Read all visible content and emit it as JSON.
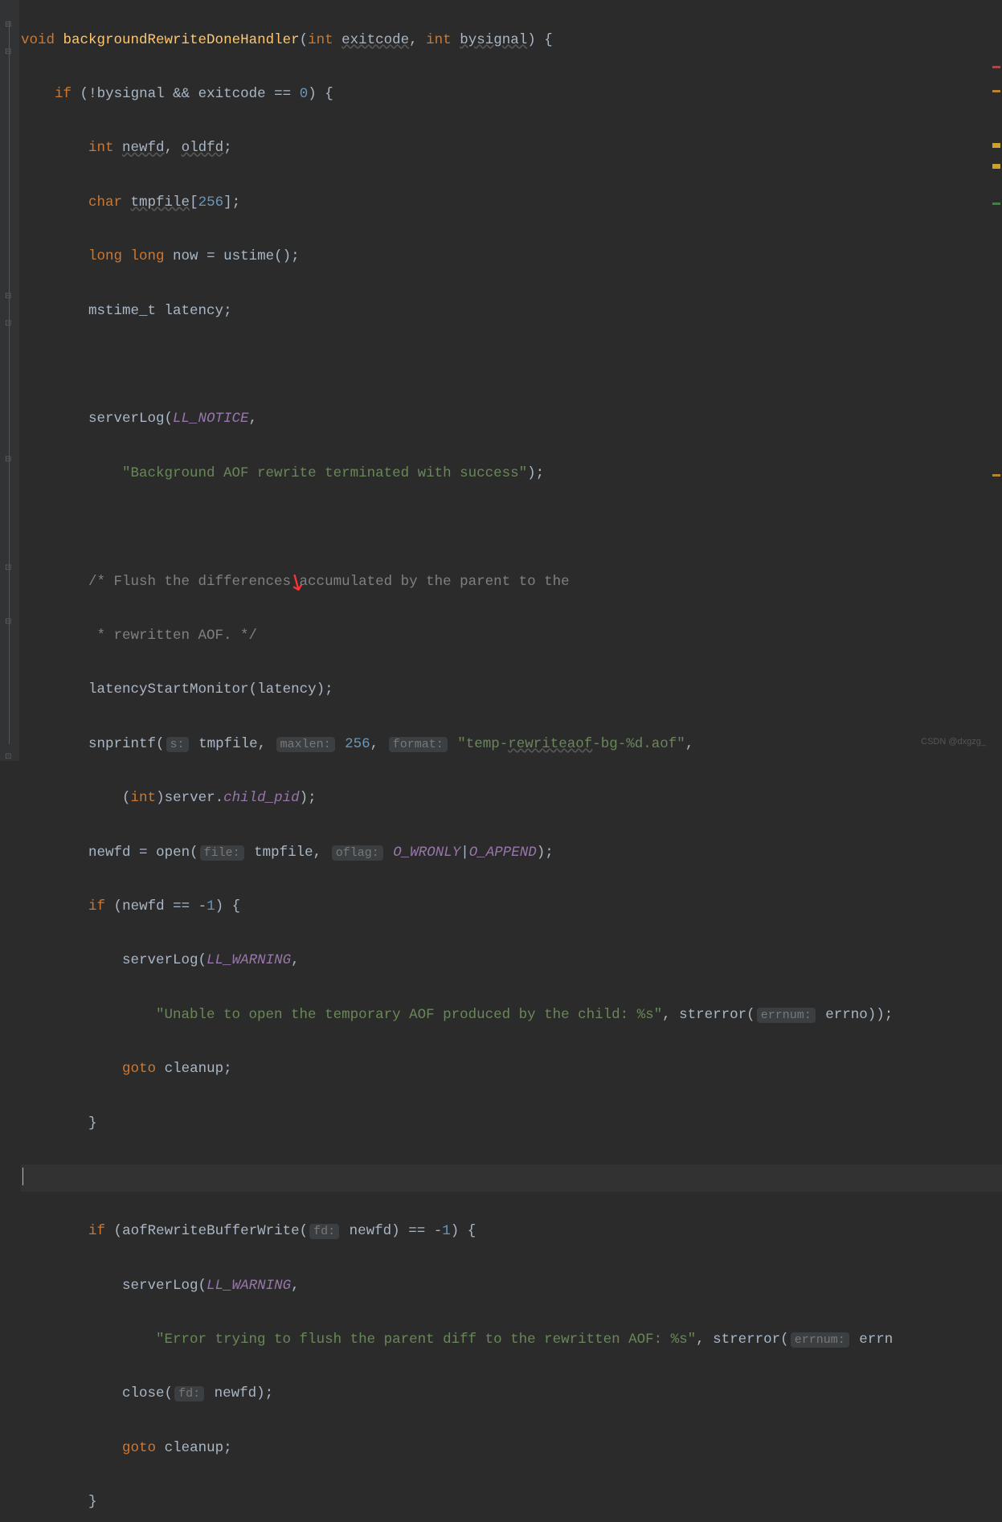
{
  "code": {
    "l1": {
      "void": "void",
      "fn": "backgroundRewriteDoneHandler",
      "int1": "int",
      "p1": "exitcode",
      "int2": "int",
      "p2": "bysignal"
    },
    "l2": {
      "if": "if",
      "not": "!",
      "v1": "bysignal",
      "and": "&&",
      "v2": "exitcode",
      "eq": "==",
      "zero": "0"
    },
    "l3": {
      "int": "int",
      "v1": "newfd",
      "v2": "oldfd"
    },
    "l4": {
      "char": "char",
      "v": "tmpfile",
      "sz": "256"
    },
    "l5": {
      "ll": "long long",
      "v": "now",
      "fn": "ustime"
    },
    "l6": {
      "t": "mstime_t",
      "v": "latency"
    },
    "l8": {
      "fn": "serverLog",
      "c": "LL_NOTICE"
    },
    "l9": {
      "s": "\"Background AOF rewrite terminated with success\""
    },
    "l11": {
      "c": "/* Flush the differences accumulated by the parent to the"
    },
    "l12": {
      "c": " * rewritten AOF. */"
    },
    "l13": {
      "fn": "latencyStartMonitor",
      "a": "latency"
    },
    "l14": {
      "fn": "snprintf",
      "h1": "s:",
      "a1": "tmpfile",
      "h2": "maxlen:",
      "a2": "256",
      "h3": "format:",
      "s": "\"temp-",
      "sU": "rewriteaof",
      "s2": "-bg-%d.aof\""
    },
    "l15": {
      "int": "int",
      "a": "server",
      "m": "child_pid"
    },
    "l16": {
      "v": "newfd",
      "fn": "open",
      "h1": "file:",
      "a1": "tmpfile",
      "h2": "oflag:",
      "c1": "O_WRONLY",
      "c2": "O_APPEND"
    },
    "l17": {
      "if": "if",
      "v": "newfd",
      "eq": "==",
      "neg": "-",
      "one": "1"
    },
    "l18": {
      "fn": "serverLog",
      "c": "LL_WARNING"
    },
    "l19": {
      "s": "\"Unable to open the temporary AOF produced by the child: %s\"",
      "fn": "strerror",
      "h": "errnum:",
      "a": "errno"
    },
    "l20": {
      "goto": "goto",
      "lbl": "cleanup"
    },
    "l23": {
      "if": "if",
      "fn": "aofRewriteBufferWrite",
      "h": "fd:",
      "a": "newfd",
      "eq": "==",
      "neg": "-",
      "one": "1"
    },
    "l24": {
      "fn": "serverLog",
      "c": "LL_WARNING"
    },
    "l25": {
      "s": "\"Error trying to flush the parent diff to the rewritten AOF: %s\"",
      "fn": "strerror",
      "h": "errnum:",
      "a": "errn"
    },
    "l26": {
      "fn": "close",
      "h": "fd:",
      "a": "newfd"
    },
    "l27": {
      "goto": "goto",
      "lbl": "cleanup"
    }
  },
  "watermark": "CSDN @dxgzg_"
}
